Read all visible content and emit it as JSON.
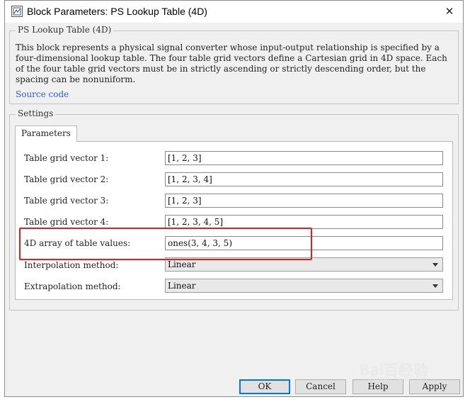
{
  "window": {
    "title": "Block Parameters: PS Lookup Table (4D)",
    "close_glyph": "✕",
    "icon": "block-parameters-icon"
  },
  "description": {
    "group_title": "PS Lookup Table (4D)",
    "text": "This block represents a physical signal converter whose input-output relationship is specified by a four-dimensional lookup table. The four table grid vectors define a Cartesian grid in 4D space. Each of the four table grid vectors must be in strictly ascending or strictly descending order, but the spacing can be nonuniform.",
    "source_link": "Source code"
  },
  "settings": {
    "group_title": "Settings",
    "tab_label": "Parameters",
    "params": [
      {
        "label": "Table grid vector 1:",
        "value": "[1, 2, 3]"
      },
      {
        "label": "Table grid vector 2:",
        "value": "[1, 2, 3, 4]"
      },
      {
        "label": "Table grid vector 3:",
        "value": "[1, 2, 3]"
      },
      {
        "label": "Table grid vector 4:",
        "value": "[1, 2, 3, 4, 5]"
      },
      {
        "label": "4D array of table values:",
        "value": "ones(3, 4, 3, 5)"
      }
    ],
    "interpolation": {
      "label": "Interpolation method:",
      "value": "Linear"
    },
    "extrapolation": {
      "label": "Extrapolation method:",
      "value": "Linear"
    }
  },
  "buttons": {
    "ok": "OK",
    "cancel": "Cancel",
    "help": "Help",
    "apply": "Apply"
  },
  "watermark": {
    "text": "Bai百经验",
    "sub": "jingyan.baidu.com"
  },
  "colors": {
    "highlight": "#e02020",
    "link": "#2f60c9",
    "ok_border": "#0078d7"
  }
}
